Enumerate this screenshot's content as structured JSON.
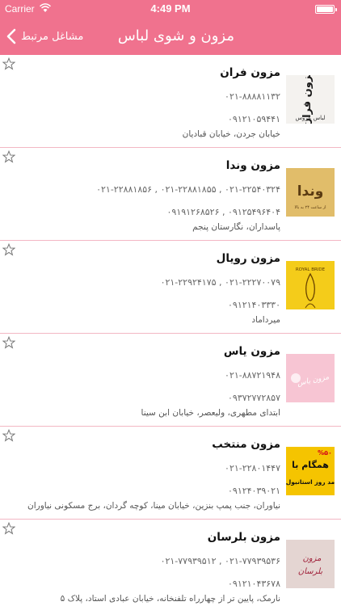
{
  "status_bar": {
    "carrier": "Carrier",
    "time": "4:49 PM"
  },
  "nav": {
    "title": "مزون و شوی لباس",
    "back_label": "مشاغل مرتبط"
  },
  "colors": {
    "accent": "#f0728e",
    "divider": "#f3b7c4"
  },
  "items": [
    {
      "name": "مزون فران",
      "phone1": "۰۲۱-۸۸۸۸۱۱۳۲",
      "phone2": "۰۹۱۲۱۰۵۹۴۴۱",
      "address": "خیابان جردن، خیابان قبادیان",
      "thumb_text": "مزون فران",
      "thumb_subtext": "لباس عروس"
    },
    {
      "name": "مزون وندا",
      "phone1": "۰۲۱-۲۲۵۴۰۳۲۴ , ۰۲۱-۲۲۸۸۱۸۵۵ , ۰۲۱-۲۲۸۸۱۸۵۶",
      "phone2": "۰۹۱۲۵۴۹۶۴۰۴ , ۰۹۱۹۱۲۶۸۵۲۶",
      "address": "پاسداران، نگارستان پنجم",
      "thumb_text": "وندا",
      "thumb_subtext": "از ساعت ۲۴ به بالا"
    },
    {
      "name": "مزون رویال",
      "phone1": "۰۲۱-۲۲۲۷۰۰۷۹ , ۰۲۱-۲۲۹۲۴۱۷۵",
      "phone2": "۰۹۱۲۱۴۰۳۳۳۰",
      "address": "میرداماد",
      "thumb_text": "ROYAL BRIDE",
      "thumb_subtext": ""
    },
    {
      "name": "مزون یاس",
      "phone1": "۰۲۱-۸۸۷۲۱۹۴۸",
      "phone2": "۰۹۳۷۲۷۷۲۸۵۷",
      "address": "ابتدای مطهری، ولیعصر، خیابان ابن سینا",
      "thumb_text": "مزون یاس",
      "thumb_subtext": ""
    },
    {
      "name": "مزون منتخب",
      "phone1": "۰۲۱-۲۲۸۰۱۴۴۷",
      "phone2": "۰۹۱۲۴۰۳۹۰۲۱",
      "address": "نیاوران، جنب پمپ بنزین، خیابان مینا، کوچه گردان، برج مسکونی نیاوران",
      "thumb_text": "همگام با",
      "thumb_subtext": "مد روز استانبول",
      "thumb_badge": "%۵۰"
    },
    {
      "name": "مزون بلرسان",
      "phone1": "۰۲۱-۷۷۹۳۹۵۳۶ , ۰۲۱-۷۷۹۳۹۵۱۲",
      "phone2": "۰۹۱۲۱۰۴۳۶۷۸",
      "address": "نارمک، پایین تر از چهارراه تلفنخانه، خیابان عبادی استاد، پلاک ۵",
      "thumb_text": "مزون",
      "thumb_subtext": "بلرسان"
    }
  ],
  "icons": {
    "star": "star-outline-icon",
    "back": "chevron-left-icon",
    "wifi": "wifi-icon",
    "battery": "battery-icon"
  }
}
